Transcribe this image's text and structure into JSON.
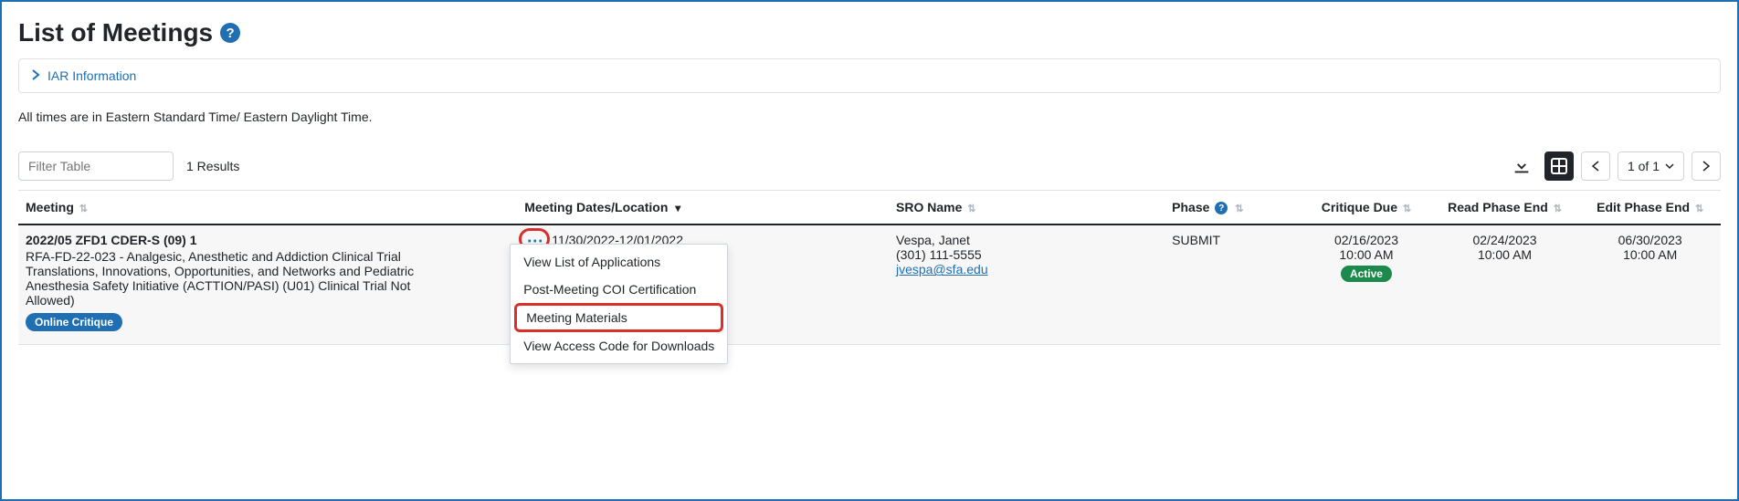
{
  "page": {
    "title": "List of Meetings",
    "accordion_label": "IAR Information",
    "timezone_note": "All times are in Eastern Standard Time/ Eastern Daylight Time.",
    "filter_placeholder": "Filter Table",
    "results_label": "1 Results",
    "pagination_label": "1 of 1"
  },
  "columns": {
    "meeting": "Meeting",
    "dates": "Meeting Dates/Location",
    "sro": "SRO Name",
    "phase": "Phase",
    "critique_due": "Critique Due",
    "read_phase_end": "Read Phase End",
    "edit_phase_end": "Edit Phase End"
  },
  "row": {
    "meeting_code": "2022/05 ZFD1 CDER-S (09) 1",
    "meeting_desc": "RFA-FD-22-023 - Analgesic, Anesthetic and Addiction Clinical Trial Translations, Innovations, Opportunities, and Networks and Pediatric Anesthesia Safety Initiative (ACTTION/PASI) (U01) Clinical Trial Not Allowed)",
    "online_badge": "Online Critique",
    "dates": "11/30/2022-12/01/2022",
    "sro_name": "Vespa, Janet",
    "sro_phone": "(301) 111-5555",
    "sro_email": "jvespa@sfa.edu",
    "phase": "SUBMIT",
    "critique_due_date": "02/16/2023",
    "critique_due_time": "10:00 AM",
    "critique_badge": "Active",
    "read_end_date": "02/24/2023",
    "read_end_time": "10:00 AM",
    "edit_end_date": "06/30/2023",
    "edit_end_time": "10:00 AM"
  },
  "menu": {
    "item1": "View List of Applications",
    "item2": "Post-Meeting COI Certification",
    "item3": "Meeting Materials",
    "item4": "View Access Code for Downloads"
  }
}
